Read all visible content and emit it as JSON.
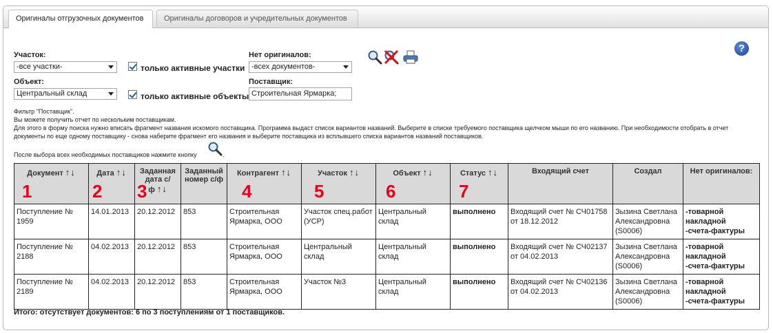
{
  "tabs": [
    {
      "label": "Оригиналы отгрузочных документов",
      "active": true
    },
    {
      "label": "Оригиналы договоров и учредительных документов",
      "active": false
    }
  ],
  "filters": {
    "section_label": "Участок:",
    "section_value": "-все участки-",
    "active_sections_label": "только активные участки",
    "object_label": "Объект:",
    "object_value": "Центральный склад",
    "active_objects_label": "только активные объекты",
    "no_originals_label": "Нет оригиналов:",
    "no_originals_value": "-всех документов-",
    "supplier_label": "Поставщик:",
    "supplier_value": "Строительная Ярмарка;"
  },
  "help_label": "?",
  "note": {
    "title": "Фильтр \"Поставщик\".",
    "line1": "Вы можете получить отчет по нескольким поставщикам.",
    "line2": "Для этого в форму поиска нужно вписать фрагмент названия искомого поставщика. Программа выдаст список вариантов названий. Выберите в списке требуемого поставщика щелчком мыши по его названию. При необходимости отобрать в отчет",
    "line3": "документы по еще одному поставщику - снова наберите фрагмент его названия и выберите поставщика из всплывшего списка вариантов названий поставщиков.",
    "line4": "После выбора всех необходимых поставщиков нажмите кнопку",
    "line4_end": "."
  },
  "table": {
    "headers": [
      {
        "label": "Документ",
        "sortable": true,
        "marker": "1"
      },
      {
        "label": "Дата",
        "sortable": true,
        "marker": "2"
      },
      {
        "label": "Заданная дата с/ф",
        "sortable": true,
        "marker": "3"
      },
      {
        "label": "Заданный номер с/ф",
        "sortable": false,
        "marker": ""
      },
      {
        "label": "Контрагент",
        "sortable": true,
        "marker": "4"
      },
      {
        "label": "Участок",
        "sortable": true,
        "marker": "5"
      },
      {
        "label": "Объект",
        "sortable": true,
        "marker": "6"
      },
      {
        "label": "Статус",
        "sortable": true,
        "marker": "7"
      },
      {
        "label": "Входящий счет",
        "sortable": false,
        "marker": ""
      },
      {
        "label": "Создал",
        "sortable": false,
        "marker": ""
      },
      {
        "label": "Нет оригиналов:",
        "sortable": false,
        "marker": ""
      }
    ],
    "sort_arrows": "↑↓",
    "rows": [
      {
        "doc": "Поступление № 1959",
        "date": "14.01.2013",
        "sf_date": "20.12.2012",
        "sf_num": "853",
        "contractor": "Строительная Ярмарка, ООО",
        "section": "Участок спец.работ (УСР)",
        "object": "Центральный склад",
        "status": "выполнено",
        "invoice": "Входящий счет № СЧ01758 от 18.12.2012",
        "creator": "Зызина Светлана Александровна (S0006)",
        "missing1": "-товарной накладной",
        "missing2": "-счета-фактуры"
      },
      {
        "doc": "Поступление № 2188",
        "date": "04.02.2013",
        "sf_date": "20.12.2012",
        "sf_num": "853",
        "contractor": "Строительная Ярмарка, ООО",
        "section": "Центральный склад",
        "object": "Центральный склад",
        "status": "выполнено",
        "invoice": "Входящий счет № СЧ02137 от 04.02.2013",
        "creator": "Зызина Светлана Александровна (S0006)",
        "missing1": "-товарной накладной",
        "missing2": "-счета-фактуры"
      },
      {
        "doc": "Поступление № 2189",
        "date": "04.02.2013",
        "sf_date": "20.12.2012",
        "sf_num": "853",
        "contractor": "Строительная Ярмарка, ООО",
        "section": "Участок №3",
        "object": "Центральный склад",
        "status": "выполнено",
        "invoice": "Входящий счет № СЧ02136 от 04.02.2013",
        "creator": "Зызина Светлана Александровна (S0006)",
        "missing1": "-товарной накладной",
        "missing2": "-счета-фактуры"
      }
    ]
  },
  "total": "Итого: отсутствует документов: 6 по 3 поступлениям от 1 поставщиков.",
  "colors": {
    "marker_red": "#e8001c",
    "header_gray": "#d9d9d9",
    "help_blue": "#1a3f8e"
  },
  "icons": [
    "search-icon",
    "clear-filter-icon",
    "print-icon",
    "help-icon"
  ]
}
